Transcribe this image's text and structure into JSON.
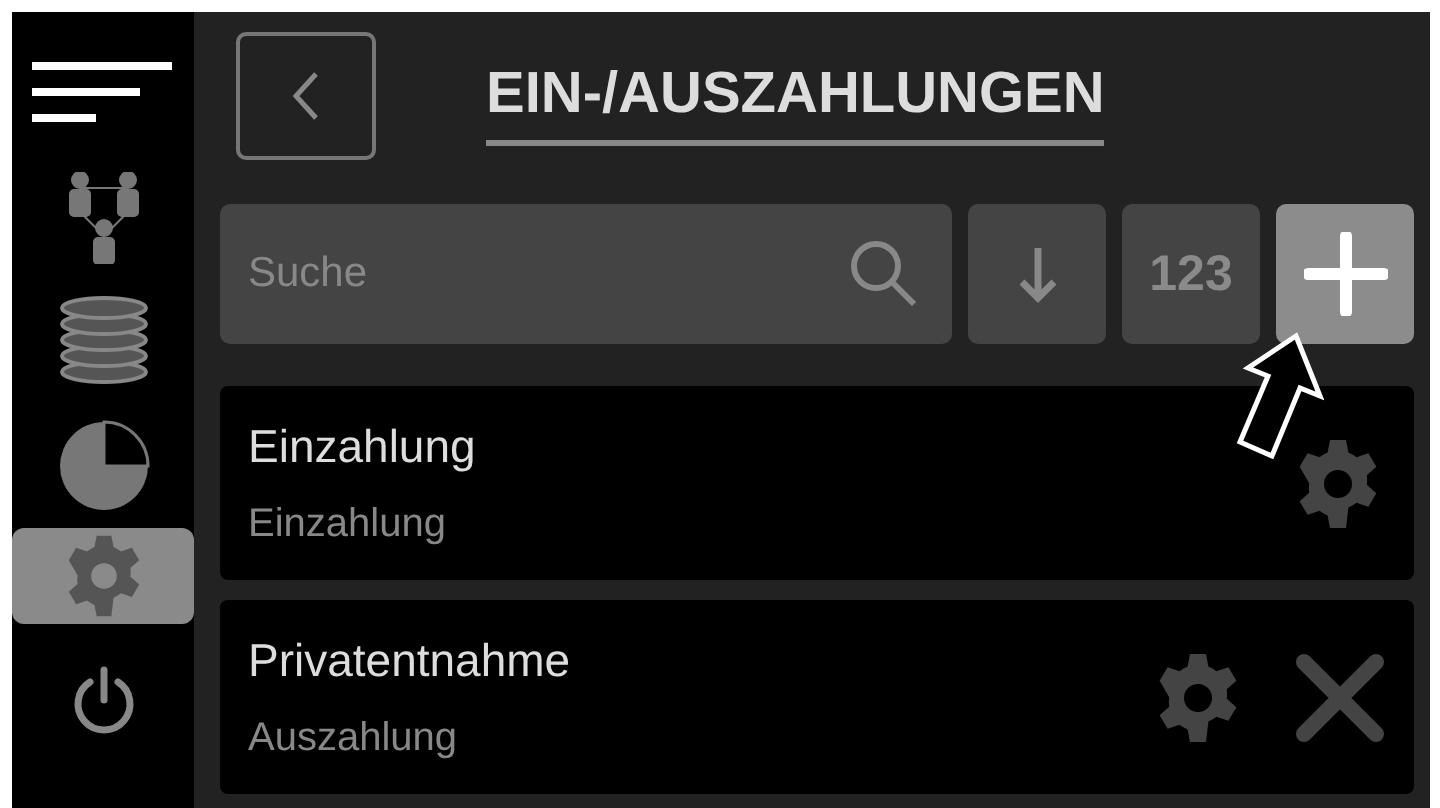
{
  "sidebar": {
    "items": [
      {
        "kind": "menu",
        "selected": false
      },
      {
        "kind": "people",
        "selected": false
      },
      {
        "kind": "database",
        "selected": false
      },
      {
        "kind": "chart",
        "selected": false
      },
      {
        "kind": "settings",
        "selected": true
      },
      {
        "kind": "power",
        "selected": false
      }
    ]
  },
  "header": {
    "title": "EIN-/AUSZAHLUNGEN"
  },
  "toolbar": {
    "search": {
      "placeholder": "Suche"
    },
    "number_button": "123"
  },
  "rows": [
    {
      "title": "Einzahlung",
      "subtitle": "Einzahlung",
      "deletable": false
    },
    {
      "title": "Privatentnahme",
      "subtitle": "Auszahlung",
      "deletable": true
    }
  ]
}
